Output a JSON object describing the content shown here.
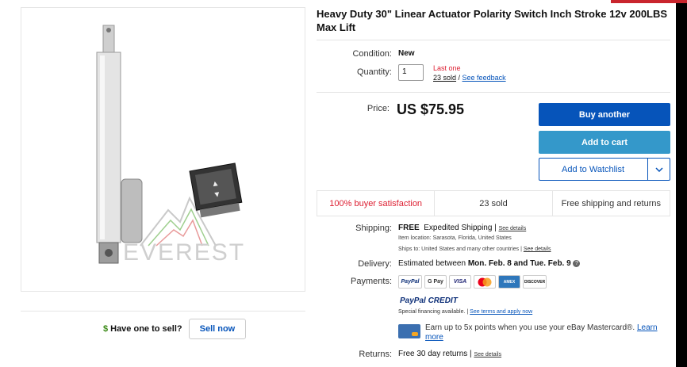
{
  "title": "Heavy Duty 30\" Linear Actuator Polarity Switch Inch Stroke 12v 200LBS Max Lift",
  "image": {
    "watermark": "EVEREST"
  },
  "sell": {
    "question": "Have one to sell?",
    "dollar_icon": "$",
    "button": "Sell now"
  },
  "condition": {
    "label": "Condition:",
    "value": "New"
  },
  "quantity": {
    "label": "Quantity:",
    "value": "1",
    "last_one": "Last one",
    "sold": "23 sold",
    "separator": " / ",
    "feedback": "See feedback"
  },
  "price": {
    "label": "Price:",
    "value": "US $75.95"
  },
  "buttons": {
    "buy": "Buy another",
    "cart": "Add to cart",
    "watch": "Add to Watchlist"
  },
  "stats": [
    "100% buyer satisfaction",
    "23 sold",
    "Free shipping and returns"
  ],
  "shipping": {
    "label": "Shipping:",
    "free": "FREE",
    "method": "Expedited Shipping |",
    "details": "See details",
    "location": "Item location:  Sarasota, Florida, United States",
    "ships_to": "Ships to:  United States and many other countries |",
    "ships_details": "See details"
  },
  "delivery": {
    "label": "Delivery:",
    "prefix": "Estimated between",
    "dates": "Mon. Feb. 8 and Tue. Feb. 9"
  },
  "payments": {
    "label": "Payments:",
    "methods": [
      "PayPal",
      "G Pay",
      "VISA",
      "MC",
      "AMEX",
      "DISCOVER"
    ],
    "paypal_credit": "PayPal CREDIT",
    "financing": "Special financing available.  |",
    "financing_link": "See terms and apply now",
    "mastercard_text": "Earn up to 5x points when you use your eBay Mastercard®.",
    "learn_more": "Learn more"
  },
  "returns": {
    "label": "Returns:",
    "value": "Free 30 day returns |",
    "details": "See details"
  },
  "colors": {
    "primary": "#0654ba",
    "cart": "#3498ca",
    "alert": "#dd1e31"
  }
}
